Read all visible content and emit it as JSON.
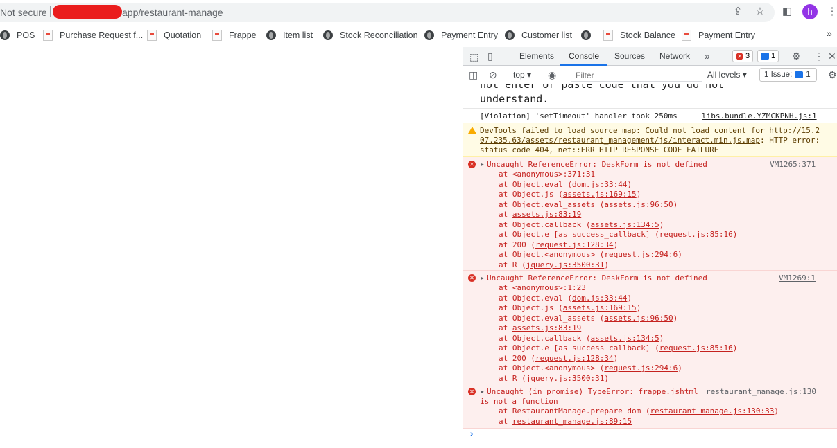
{
  "browser": {
    "security": "Not secure",
    "url": "app/restaurant-manage",
    "avatar_letter": "h"
  },
  "bookmarks": [
    {
      "label": "POS",
      "icon": "globe-icon"
    },
    {
      "label": "Purchase Request f...",
      "icon": "doc-icon"
    },
    {
      "label": "Quotation",
      "icon": "doc-icon"
    },
    {
      "label": "Frappe",
      "icon": "doc-icon"
    },
    {
      "label": "Item list",
      "icon": "globe-icon"
    },
    {
      "label": "Stock Reconciliation",
      "icon": "globe-icon"
    },
    {
      "label": "Payment Entry",
      "icon": "globe-icon"
    },
    {
      "label": "Customer list",
      "icon": "globe-icon"
    },
    {
      "label": "",
      "icon": "globe-icon"
    },
    {
      "label": "Stock Balance",
      "icon": "doc-icon"
    },
    {
      "label": "Payment Entry",
      "icon": "doc-icon"
    }
  ],
  "devtools": {
    "tabs": [
      "Elements",
      "Console",
      "Sources",
      "Network"
    ],
    "active_tab": "Console",
    "error_count": "3",
    "message_count": "1",
    "context": "top",
    "filter_placeholder": "Filter",
    "levels": "All levels",
    "issues_label": "1 Issue:",
    "issues_count": "1"
  },
  "console": {
    "intro": [
      "not enter or paste code that you do not",
      "understand."
    ],
    "violation": {
      "text": "[Violation] 'setTimeout' handler took 250ms",
      "source": "libs.bundle.YZMCKPNH.js:1"
    },
    "sourcemap_warning": {
      "line1": "DevTools failed to load source map: Could not load content for ",
      "link1": "http://15.2",
      "link2": "07.235.63/assets/restaurant_management/js/interact.min.js.map",
      "tail2": ": HTTP error:",
      "line3": "status code 404, net::ERR_HTTP_RESPONSE_CODE_FAILURE"
    },
    "errors": [
      {
        "message": "Uncaught ReferenceError: DeskForm is not defined",
        "source": "VM1265:371",
        "stack": [
          {
            "pre": "at <anonymous>:371:31",
            "link": "",
            "post": ""
          },
          {
            "pre": "at Object.eval (",
            "link": "dom.js:33:44",
            "post": ")"
          },
          {
            "pre": "at Object.js (",
            "link": "assets.js:169:15",
            "post": ")"
          },
          {
            "pre": "at Object.eval_assets (",
            "link": "assets.js:96:50",
            "post": ")"
          },
          {
            "pre": "at ",
            "link": "assets.js:83:19",
            "post": ""
          },
          {
            "pre": "at Object.callback (",
            "link": "assets.js:134:5",
            "post": ")"
          },
          {
            "pre": "at Object.e [as success_callback] (",
            "link": "request.js:85:16",
            "post": ")"
          },
          {
            "pre": "at 200 (",
            "link": "request.js:128:34",
            "post": ")"
          },
          {
            "pre": "at Object.<anonymous> (",
            "link": "request.js:294:6",
            "post": ")"
          },
          {
            "pre": "at R (",
            "link": "jquery.js:3500:31",
            "post": ")"
          }
        ]
      },
      {
        "message": "Uncaught ReferenceError: DeskForm is not defined",
        "source": "VM1269:1",
        "stack": [
          {
            "pre": "at <anonymous>:1:23",
            "link": "",
            "post": ""
          },
          {
            "pre": "at Object.eval (",
            "link": "dom.js:33:44",
            "post": ")"
          },
          {
            "pre": "at Object.js (",
            "link": "assets.js:169:15",
            "post": ")"
          },
          {
            "pre": "at Object.eval_assets (",
            "link": "assets.js:96:50",
            "post": ")"
          },
          {
            "pre": "at ",
            "link": "assets.js:83:19",
            "post": ""
          },
          {
            "pre": "at Object.callback (",
            "link": "assets.js:134:5",
            "post": ")"
          },
          {
            "pre": "at Object.e [as success_callback] (",
            "link": "request.js:85:16",
            "post": ")"
          },
          {
            "pre": "at 200 (",
            "link": "request.js:128:34",
            "post": ")"
          },
          {
            "pre": "at Object.<anonymous> (",
            "link": "request.js:294:6",
            "post": ")"
          },
          {
            "pre": "at R (",
            "link": "jquery.js:3500:31",
            "post": ")"
          }
        ]
      }
    ],
    "promise_error": {
      "message": "Uncaught (in promise) TypeError: frappe.jshtml",
      "message2": "is not a function",
      "source": "restaurant_manage.js:130",
      "stack": [
        {
          "pre": "at RestaurantManage.prepare_dom (",
          "link": "restaurant_manage.js:130:33",
          "post": ")"
        },
        {
          "pre": "at ",
          "link": "restaurant_manage.js:89:15",
          "post": ""
        }
      ]
    },
    "prompt": "›"
  }
}
